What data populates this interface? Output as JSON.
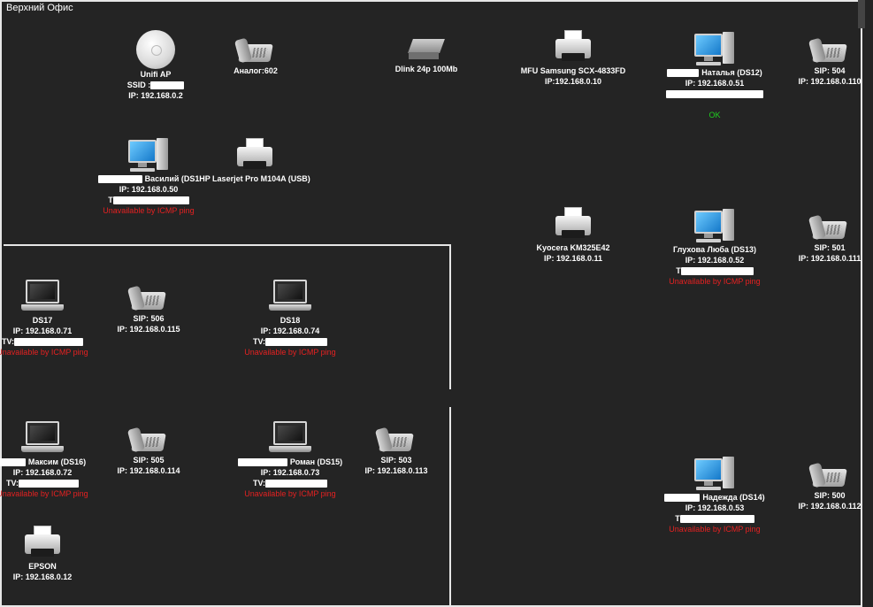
{
  "room": {
    "title": "Верхний Офис"
  },
  "nodes": {
    "unifi": {
      "icon": "access-point-icon",
      "lines": [
        "Unifi AP",
        "SSID :",
        "IP: 192.168.0.2"
      ]
    },
    "analog": {
      "icon": "desk-phone-icon",
      "lines": [
        "Аналог:602"
      ]
    },
    "dlink": {
      "icon": "network-switch-icon",
      "lines": [
        "Dlink 24p 100Mb"
      ]
    },
    "mfu": {
      "icon": "printer-icon",
      "lines": [
        "MFU Samsung SCX-4833FD",
        "IP:192.168.0.10"
      ]
    },
    "ds12": {
      "icon": "desktop-pc-icon",
      "lines": [
        "Наталья (DS12)",
        "IP: 192.168.0.51",
        ""
      ],
      "status": "OK"
    },
    "sip504": {
      "icon": "desk-phone-icon",
      "lines": [
        "SIP: 504",
        "IP: 192.168.0.110"
      ]
    },
    "ds11": {
      "icon": "desktop-pc-icon",
      "lines": [
        "Василий (DS1",
        "IP: 192.168.0.50",
        "T"
      ],
      "status": "Unavailable by ICMP ping"
    },
    "hp": {
      "icon": "printer-icon",
      "lines": [
        "HP Laserjet Pro M104A (USB)"
      ]
    },
    "kyocera": {
      "icon": "printer-icon",
      "lines": [
        "Kyocera KM325E42",
        "IP: 192.168.0.11"
      ]
    },
    "ds13": {
      "icon": "desktop-pc-icon",
      "lines": [
        "Глухова Люба (DS13)",
        "IP: 192.168.0.52",
        "T"
      ],
      "status": "Unavailable by ICMP ping"
    },
    "sip501": {
      "icon": "desk-phone-icon",
      "lines": [
        "SIP: 501",
        "IP: 192.168.0.111"
      ]
    },
    "ds17": {
      "icon": "laptop-icon",
      "lines": [
        "DS17",
        "IP: 192.168.0.71",
        "TV:"
      ],
      "status": "Unavailable by ICMP ping"
    },
    "sip506": {
      "icon": "desk-phone-icon",
      "lines": [
        "SIP: 506",
        "IP: 192.168.0.115"
      ]
    },
    "ds18": {
      "icon": "laptop-icon",
      "lines": [
        "DS18",
        "IP: 192.168.0.74",
        "TV:"
      ],
      "status": "Unavailable by ICMP ping"
    },
    "ds16": {
      "icon": "laptop-icon",
      "lines": [
        "Максим (DS16)",
        "IP: 192.168.0.72",
        "TV:"
      ],
      "status": "Unavailable by ICMP ping"
    },
    "sip505": {
      "icon": "desk-phone-icon",
      "lines": [
        "SIP: 505",
        "IP: 192.168.0.114"
      ]
    },
    "ds15": {
      "icon": "laptop-icon",
      "lines": [
        "Роман (DS15)",
        "IP: 192.168.0.73",
        "TV:"
      ],
      "status": "Unavailable by ICMP ping"
    },
    "sip503": {
      "icon": "desk-phone-icon",
      "lines": [
        "SIP: 503",
        "IP: 192.168.0.113"
      ]
    },
    "ds14": {
      "icon": "desktop-pc-icon",
      "lines": [
        "Надежда (DS14)",
        "IP: 192.168.0.53",
        "T"
      ],
      "status": "Unavailable by ICMP ping"
    },
    "sip500": {
      "icon": "desk-phone-icon",
      "lines": [
        "SIP: 500",
        "IP: 192.168.0.112"
      ]
    },
    "epson": {
      "icon": "printer-icon",
      "lines": [
        "EPSON",
        "IP: 192.168.0.12"
      ]
    }
  },
  "colors": {
    "background": "#242424",
    "wall": "#e6e6e6",
    "label": "#ffffff",
    "error": "#e52121",
    "ok": "#1fd11f"
  }
}
